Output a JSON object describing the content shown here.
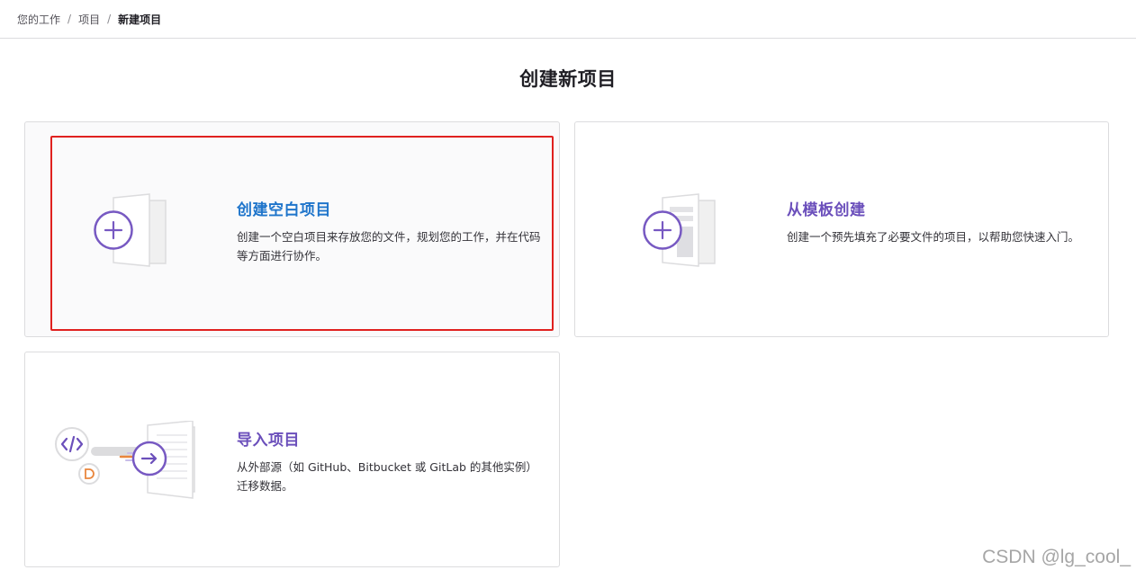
{
  "breadcrumb": {
    "items": [
      "您的工作",
      "项目",
      "新建项目"
    ],
    "separator": "/"
  },
  "page": {
    "title": "创建新项目"
  },
  "cards": {
    "blank": {
      "title": "创建空白项目",
      "description": "创建一个空白项目来存放您的文件，规划您的工作，并在代码等方面进行协作。",
      "icon": "plus-icon"
    },
    "template": {
      "title": "从模板创建",
      "description": "创建一个预先填充了必要文件的项目，以帮助您快速入门。",
      "icon": "plus-icon"
    },
    "import": {
      "title": "导入项目",
      "description": "从外部源（如 GitHub、Bitbucket 或 GitLab 的其他实例）迁移数据。",
      "icon": "arrow-right-icon"
    }
  },
  "watermark": "CSDN @lg_cool_",
  "colors": {
    "accent_purple": "#6b4fbb",
    "accent_blue": "#1f75cb",
    "highlight_red": "#e0211f",
    "accent_orange": "#e9863d"
  }
}
